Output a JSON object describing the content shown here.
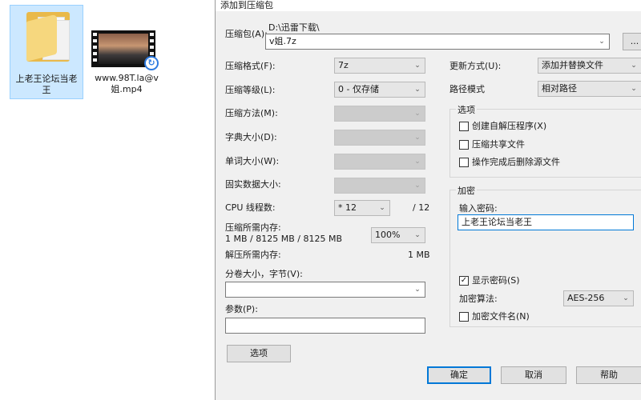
{
  "desktop": {
    "folder": {
      "label": "上老王论坛当老王",
      "icon": "folder-icon"
    },
    "video": {
      "label": "www.98T.la@v姐.mp4",
      "icon": "video-file-icon"
    }
  },
  "dialog": {
    "title": "添加到压缩包",
    "archive": {
      "label": "压缩包(A):",
      "path": "D:\\迅雷下载\\",
      "value": "v姐.7z",
      "browse_label": "..."
    },
    "left": {
      "format": {
        "label": "压缩格式(F):",
        "value": "7z"
      },
      "level": {
        "label": "压缩等级(L):",
        "value": "0 - 仅存储"
      },
      "method": {
        "label": "压缩方法(M):"
      },
      "dict": {
        "label": "字典大小(D):"
      },
      "word": {
        "label": "单词大小(W):"
      },
      "solid": {
        "label": "固实数据大小:"
      },
      "threads": {
        "label": "CPU 线程数:",
        "value": "* 12",
        "max": "/ 12"
      },
      "mem_compress": {
        "label": "压缩所需内存:",
        "detail": "1 MB / 8125 MB / 8125 MB",
        "percent": "100%"
      },
      "mem_decompress": {
        "label": "解压所需内存:",
        "value": "1 MB"
      },
      "split": {
        "label": "分卷大小，字节(V):",
        "value": ""
      },
      "params": {
        "label": "参数(P):",
        "value": ""
      },
      "options_button": "选项"
    },
    "right": {
      "update": {
        "label": "更新方式(U):",
        "value": "添加并替换文件"
      },
      "path_mode": {
        "label": "路径模式",
        "value": "相对路径"
      },
      "options_group": {
        "title": "选项",
        "sfx": {
          "label": "创建自解压程序(X)",
          "checked": false
        },
        "shared": {
          "label": "压缩共享文件",
          "checked": false
        },
        "delete": {
          "label": "操作完成后删除源文件",
          "checked": false
        }
      },
      "encrypt_group": {
        "title": "加密",
        "password_label": "输入密码:",
        "password_value": "上老王论坛当老王",
        "show_password": {
          "label": "显示密码(S)",
          "checked": true
        },
        "method": {
          "label": "加密算法:",
          "value": "AES-256"
        },
        "encrypt_names": {
          "label": "加密文件名(N)",
          "checked": false
        }
      }
    },
    "buttons": {
      "ok": "确定",
      "cancel": "取消",
      "help": "帮助"
    }
  }
}
